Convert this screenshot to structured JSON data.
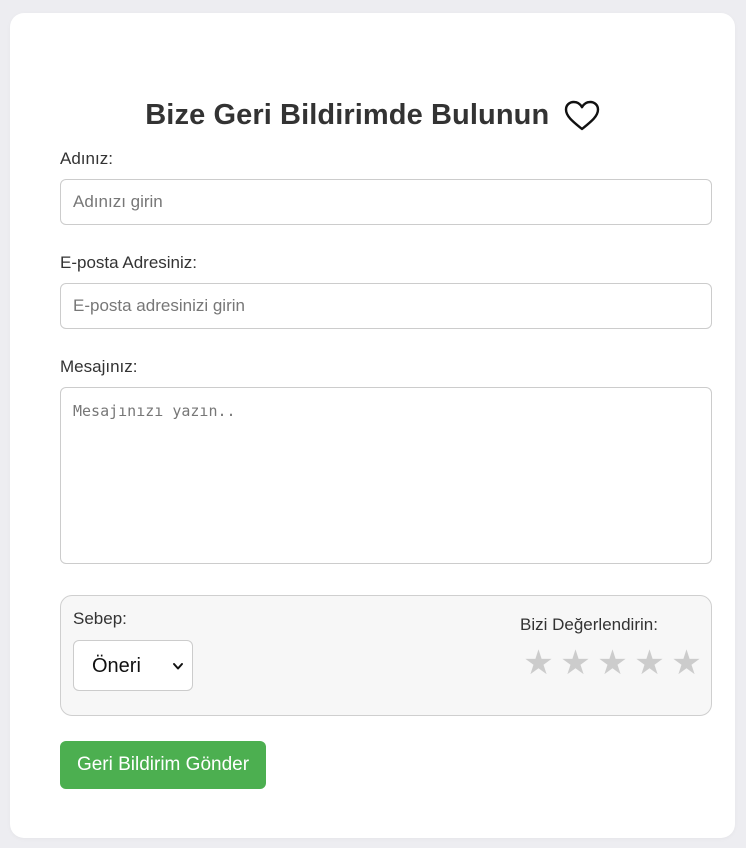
{
  "form": {
    "title": "Bize Geri Bildirimde Bulunun",
    "title_icon": "heart-icon",
    "name_label": "Adınız:",
    "name_placeholder": "Adınızı girin",
    "email_label": "E-posta Adresiniz:",
    "email_placeholder": "E-posta adresinizi girin",
    "message_label": "Mesajınız:",
    "message_placeholder": "Mesajınızı yazın..",
    "reason_label": "Sebep:",
    "reason_selected": "Öneri",
    "rating_label": "Bizi Değerlendirin:",
    "rating_value": 0,
    "rating_max": 5,
    "star_glyph": "★",
    "submit_label": "Geri Bildirim Gönder"
  },
  "colors": {
    "page_background": "#ededf1",
    "card_background": "#ffffff",
    "accent_green": "#4caf50",
    "star_inactive": "#cccccc",
    "text": "#333333"
  }
}
